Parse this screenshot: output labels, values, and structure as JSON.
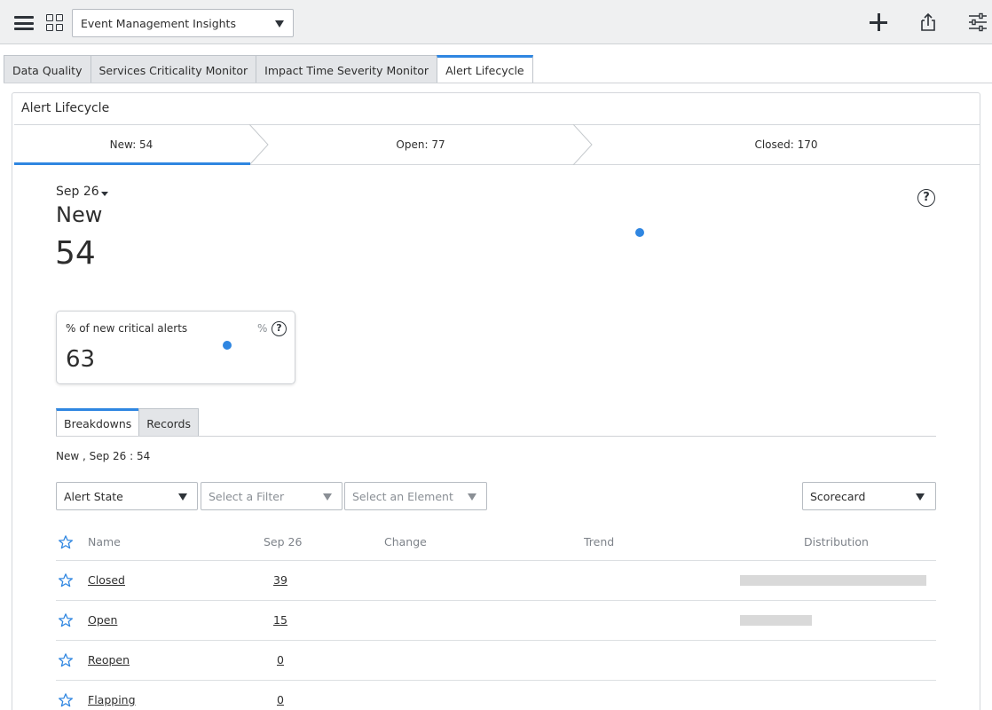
{
  "toolbar": {
    "dashboard_select": "Event Management Insights",
    "icons": [
      "menu-icon",
      "grid-icon",
      "plus-icon",
      "share-icon",
      "settings-sliders-icon"
    ]
  },
  "dashboard_tabs": [
    {
      "label": "Data Quality",
      "active": false
    },
    {
      "label": "Services Criticality Monitor",
      "active": false
    },
    {
      "label": "Impact Time Severity Monitor",
      "active": false
    },
    {
      "label": "Alert Lifecycle",
      "active": true
    }
  ],
  "widget": {
    "title": "Alert Lifecycle",
    "steps": [
      {
        "label": "New: 54",
        "active": true
      },
      {
        "label": "Open: 77",
        "active": false
      },
      {
        "label": "Closed: 170",
        "active": false
      }
    ],
    "date": "Sep 26",
    "state_label": "New",
    "state_value": "54",
    "kpi": {
      "title": "% of new critical alerts",
      "unit": "%",
      "value": "63"
    },
    "subtabs": [
      {
        "label": "Breakdowns",
        "active": true
      },
      {
        "label": "Records",
        "active": false
      }
    ],
    "summary": "New , Sep 26 : 54",
    "filters": {
      "breakdown": "Alert State",
      "filter_placeholder": "Select a Filter",
      "element_placeholder": "Select an Element",
      "view": "Scorecard"
    },
    "table": {
      "headers": {
        "name": "Name",
        "date": "Sep 26",
        "change": "Change",
        "trend": "Trend",
        "distribution": "Distribution"
      },
      "rows": [
        {
          "name": "Closed",
          "value": "39",
          "distribution": 39
        },
        {
          "name": "Open",
          "value": "15",
          "distribution": 15
        },
        {
          "name": "Reopen",
          "value": "0",
          "distribution": 0
        },
        {
          "name": "Flapping",
          "value": "0",
          "distribution": 0
        }
      ]
    }
  },
  "colors": {
    "accent": "#2f86e1",
    "toolbar_bg": "#eff0f1",
    "bar": "#d9d9d9"
  }
}
